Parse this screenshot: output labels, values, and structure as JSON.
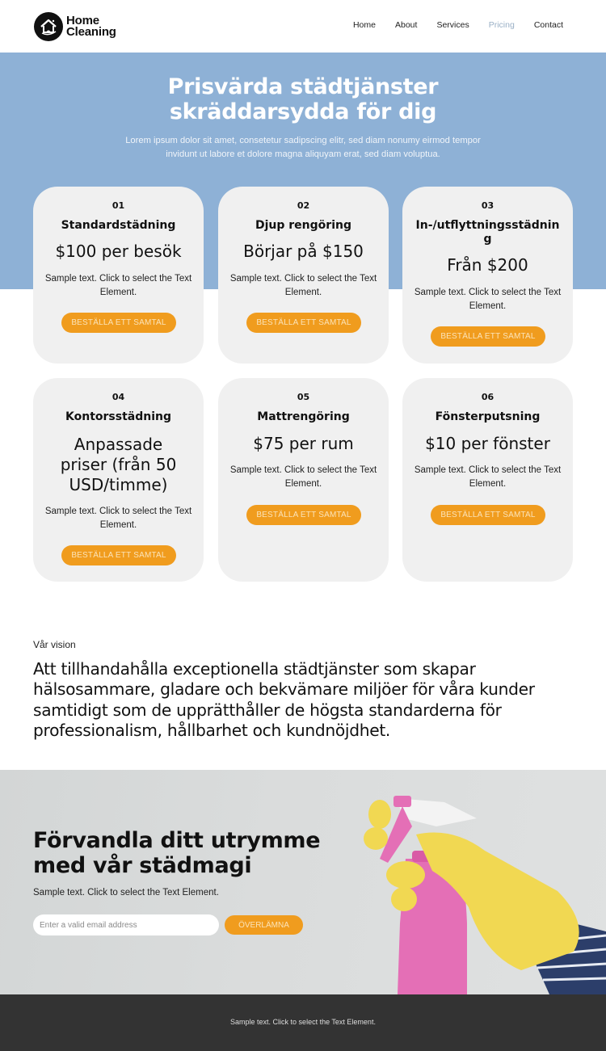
{
  "header": {
    "logo_line1": "Home",
    "logo_line2": "Cleaning",
    "logo_icon": "house-icon",
    "nav": [
      {
        "label": "Home",
        "active": false
      },
      {
        "label": "About",
        "active": false
      },
      {
        "label": "Services",
        "active": false
      },
      {
        "label": "Pricing",
        "active": true
      },
      {
        "label": "Contact",
        "active": false
      }
    ]
  },
  "hero": {
    "title_line1": "Prisvärda städtjänster",
    "title_line2": "skräddarsydda för dig",
    "text": "Lorem ipsum dolor sit amet, consetetur sadipscing elitr, sed diam nonumy eirmod tempor invidunt ut labore et dolore magna aliquyam erat, sed diam voluptua."
  },
  "pricing": {
    "cards": [
      {
        "num": "01",
        "title": "Standardstädning",
        "price": "$100 per besök",
        "desc": "Sample text. Click to select the Text Element.",
        "button": "BESTÄLLA ETT SAMTAL"
      },
      {
        "num": "02",
        "title": "Djup rengöring",
        "price": "Börjar på $150",
        "desc": "Sample text. Click to select the Text Element.",
        "button": "BESTÄLLA ETT SAMTAL"
      },
      {
        "num": "03",
        "title": "In-/utflyttningsstädning",
        "price": "Från $200",
        "desc": "Sample text. Click to select the Text Element.",
        "button": "BESTÄLLA ETT SAMTAL"
      },
      {
        "num": "04",
        "title": "Kontorsstädning",
        "price": "Anpassade priser (från 50 USD/timme)",
        "desc": "Sample text. Click to select the Text Element.",
        "button": "BESTÄLLA ETT SAMTAL"
      },
      {
        "num": "05",
        "title": "Mattrengöring",
        "price": "$75 per rum",
        "desc": "Sample text. Click to select the Text Element.",
        "button": "BESTÄLLA ETT SAMTAL"
      },
      {
        "num": "06",
        "title": "Fönsterputsning",
        "price": "$10 per fönster",
        "desc": "Sample text. Click to select the Text Element.",
        "button": "BESTÄLLA ETT SAMTAL"
      }
    ]
  },
  "vision": {
    "label": "Vår vision",
    "text": "Att tillhandahålla exceptionella städtjänster som skapar hälsosammare, gladare och bekvämare miljöer för våra kunder samtidigt som de upprätthåller de högsta standarderna för professionalism, hållbarhet och kundnöjdhet."
  },
  "cta": {
    "title_line1": "Förvandla ditt utrymme",
    "title_line2": "med vår städmagi",
    "text": "Sample text. Click to select the Text Element.",
    "email_placeholder": "Enter a valid email address",
    "email_value": "",
    "submit_label": "ÖVERLÄMNA",
    "image": "gloved-hand-spray-bottle"
  },
  "footer": {
    "text": "Sample text. Click to select the Text Element."
  },
  "colors": {
    "hero_bg": "#8eb1d6",
    "accent": "#f09c1e",
    "card_bg": "#f0f0f0",
    "nav_active": "#9ab0c6",
    "footer_bg": "#333333"
  }
}
